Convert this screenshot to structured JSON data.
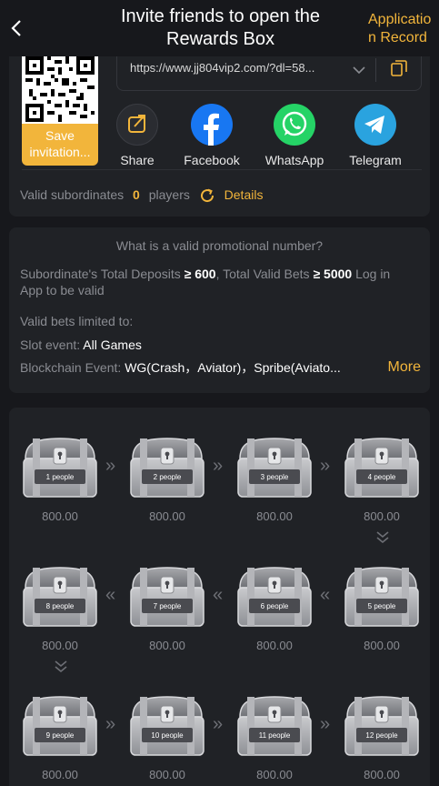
{
  "header": {
    "title": "Invite friends to open the Rewards Box",
    "application_record": "Application Record"
  },
  "invite": {
    "save_label": "Save invitation...",
    "link": "https://www.jj804vip2.com/?dl=58...",
    "share": [
      {
        "label": "Share",
        "icon": "share-icon",
        "color": "#2a2c31"
      },
      {
        "label": "Facebook",
        "icon": "facebook-icon",
        "color": "#1877f2"
      },
      {
        "label": "WhatsApp",
        "icon": "whatsapp-icon",
        "color": "#25d366"
      },
      {
        "label": "Telegram",
        "icon": "telegram-icon",
        "color": "#2aa3df"
      }
    ],
    "valid_subordinates_label": "Valid subordinates",
    "valid_subordinates_count": "0",
    "players_label": "players",
    "details_label": "Details"
  },
  "rules": {
    "title": "What is a valid promotional number?",
    "deposit_prefix": "Subordinate's Total Deposits",
    "deposit_op": "≥",
    "deposit_value": "600",
    "bets_prefix": ",  Total Valid Bets",
    "bets_op": "≥",
    "bets_value": "5000",
    "bets_suffix": "Log in",
    "line2": "App to be valid",
    "limited": "Valid bets limited to:",
    "slot_label": "Slot event:",
    "slot_value": "All Games",
    "blockchain_label": "Blockchain Event:",
    "blockchain_value": "WG(Crash，Aviator)，Spribe(Aviato...",
    "more_label": "More"
  },
  "boxes": [
    {
      "people": "1 people",
      "amount": "800.00"
    },
    {
      "people": "2 people",
      "amount": "800.00"
    },
    {
      "people": "3 people",
      "amount": "800.00"
    },
    {
      "people": "4 people",
      "amount": "800.00"
    },
    {
      "people": "5 people",
      "amount": "800.00"
    },
    {
      "people": "6 people",
      "amount": "800.00"
    },
    {
      "people": "7 people",
      "amount": "800.00"
    },
    {
      "people": "8 people",
      "amount": "800.00"
    },
    {
      "people": "9 people",
      "amount": "800.00"
    },
    {
      "people": "10 people",
      "amount": "800.00"
    },
    {
      "people": "11 people",
      "amount": "800.00"
    },
    {
      "people": "12 people",
      "amount": "800.00"
    }
  ],
  "colors": {
    "accent": "#f2b53b",
    "background": "#17181c",
    "card": "#202226"
  }
}
